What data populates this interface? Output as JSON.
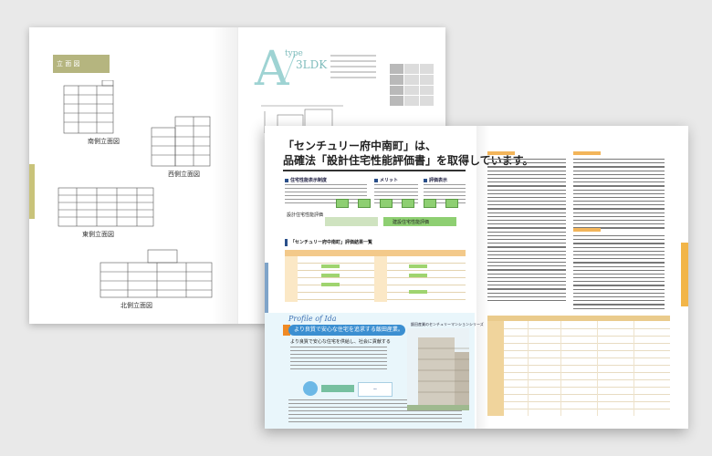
{
  "back_spread": {
    "elevation_header": "立 面 図",
    "elevations": [
      {
        "label": "南側立面図"
      },
      {
        "label": "西側立面図"
      },
      {
        "label": "東側立面図"
      },
      {
        "label": "北側立面図"
      }
    ],
    "plan_type": {
      "letter": "A",
      "word": "type",
      "layout": "3LDK"
    }
  },
  "front_spread": {
    "title_line1": "「センチュリー府中南町」は、",
    "title_line2": "品確法「設計住宅性能評価書」を取得しています。",
    "sections": {
      "system": "住宅性能表示制度",
      "merit": "メリット",
      "evaluation": "評価表示"
    },
    "flow_labels": {
      "design_eval": "設計住宅性能評価",
      "construct_eval": "建設住宅性能評価"
    },
    "grade_table_title": "「センチュリー府中南町」評価結果一覧",
    "profile": {
      "title": "Profile of Ida",
      "banner": "より良質で安心な住宅を追求する飯田産業。",
      "sub": "より良質で安心な住宅を供給し、社会に貢献する",
      "series": "飯田産業のセンチュリーマンションシリーズ"
    }
  },
  "colors": {
    "elevation_header": "#b5b57f",
    "plan_accent": "#9ed3d3",
    "flow_green": "#8ecf72",
    "orange_accent": "#f2b548",
    "profile_blue": "#3b8fd1",
    "profile_bg": "#e9f6fb"
  }
}
